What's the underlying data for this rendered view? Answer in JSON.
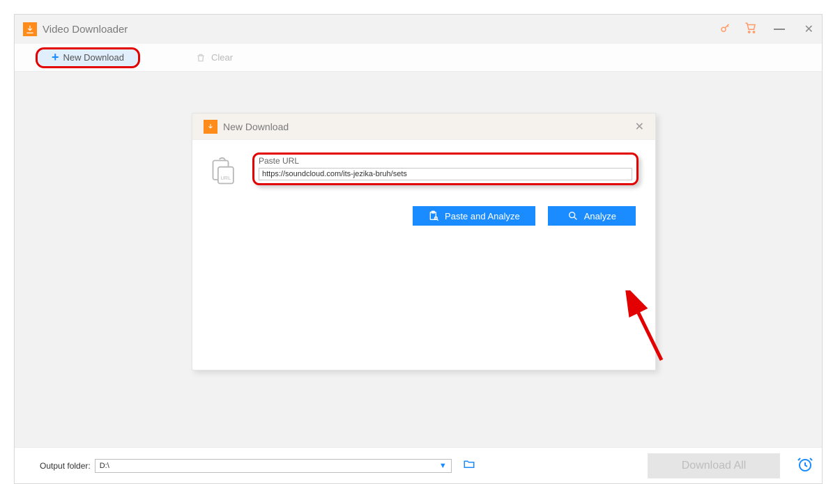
{
  "app": {
    "title": "Video Downloader"
  },
  "tabs": {
    "new_download": "New Download",
    "clear": "Clear"
  },
  "dialog": {
    "title": "New Download",
    "url_label": "Paste URL",
    "url_value": "https://soundcloud.com/its-jezika-bruh/sets",
    "paste_btn": "Paste and Analyze",
    "analyze_btn": "Analyze"
  },
  "footer": {
    "label": "Output folder:",
    "value": "D:\\",
    "download_all": "Download All"
  }
}
